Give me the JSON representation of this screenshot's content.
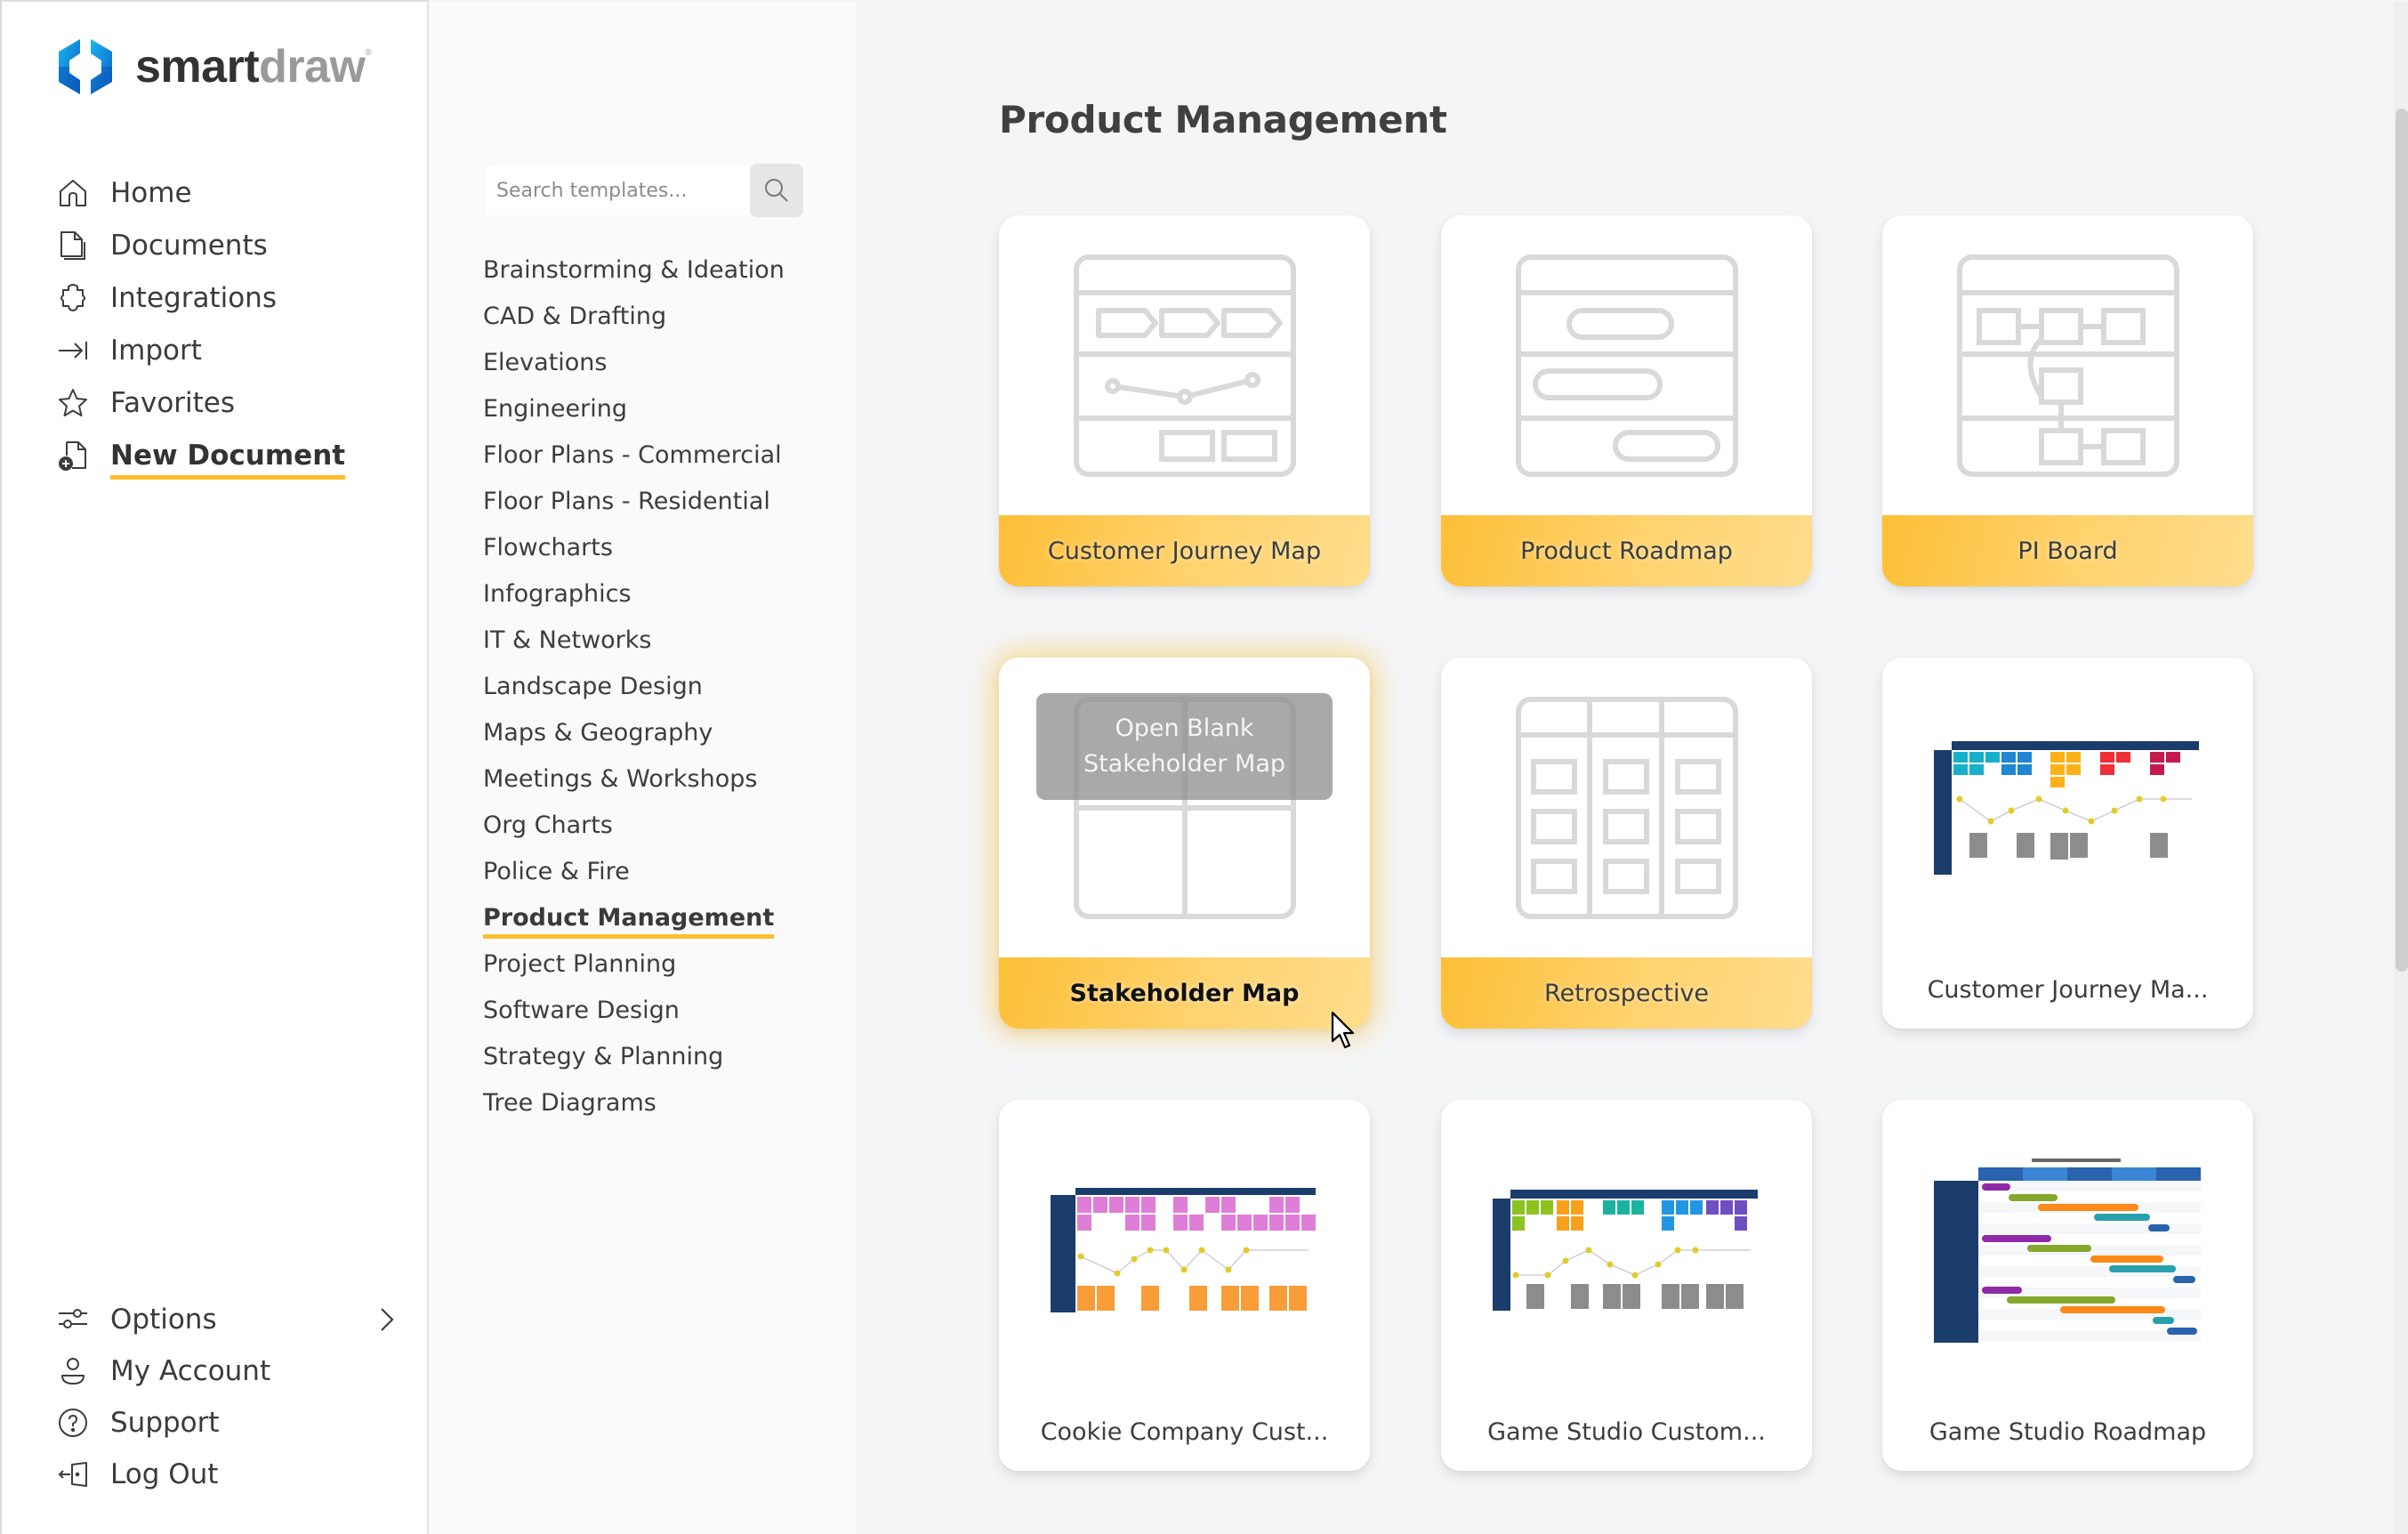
{
  "app": {
    "logo_primary": "smart",
    "logo_secondary": "draw",
    "logo_mark": "®",
    "brand_accent": "#fbbf2d",
    "brand_blue": "#1a7fd8"
  },
  "sidebar": {
    "nav_items": [
      {
        "label": "Home",
        "icon": "home-icon"
      },
      {
        "label": "Documents",
        "icon": "documents-icon"
      },
      {
        "label": "Integrations",
        "icon": "puzzle-icon"
      },
      {
        "label": "Import",
        "icon": "import-icon"
      },
      {
        "label": "Favorites",
        "icon": "star-icon"
      },
      {
        "label": "New Document",
        "icon": "new-document-icon",
        "active": true
      }
    ],
    "bottom_items": [
      {
        "label": "Options",
        "icon": "sliders-icon",
        "has_submenu": true
      },
      {
        "label": "My Account",
        "icon": "user-icon"
      },
      {
        "label": "Support",
        "icon": "help-icon"
      },
      {
        "label": "Log Out",
        "icon": "logout-icon"
      }
    ]
  },
  "categories": {
    "search_placeholder": "Search templates...",
    "search_value": "",
    "items": [
      "Brainstorming & Ideation",
      "CAD & Drafting",
      "Elevations",
      "Engineering",
      "Floor Plans - Commercial",
      "Floor Plans - Residential",
      "Flowcharts",
      "Infographics",
      "IT & Networks",
      "Landscape Design",
      "Maps & Geography",
      "Meetings & Workshops",
      "Org Charts",
      "Police & Fire",
      "Product Management",
      "Project Planning",
      "Software Design",
      "Strategy & Planning",
      "Tree Diagrams"
    ],
    "active": "Product Management"
  },
  "main": {
    "title": "Product Management",
    "cards": [
      {
        "label": "Customer Journey Map",
        "kind": "blank",
        "icon": "customer-journey-map-icon"
      },
      {
        "label": "Product Roadmap",
        "kind": "blank",
        "icon": "product-roadmap-icon"
      },
      {
        "label": "PI Board",
        "kind": "blank",
        "icon": "pi-board-icon"
      },
      {
        "label": "Stakeholder Map",
        "kind": "blank",
        "icon": "stakeholder-map-icon",
        "hovered": true,
        "overlay_line1": "Open Blank",
        "overlay_line2": "Stakeholder Map"
      },
      {
        "label": "Retrospective",
        "kind": "blank",
        "icon": "retrospective-icon"
      },
      {
        "label": "Customer Journey Ma...",
        "kind": "template",
        "thumb": "journey-map-thumbnail"
      },
      {
        "label": "Cookie Company Cust...",
        "kind": "template",
        "thumb": "cookie-journey-thumbnail"
      },
      {
        "label": "Game Studio Custom...",
        "kind": "template",
        "thumb": "game-studio-journey-thumbnail"
      },
      {
        "label": "Game Studio Roadmap",
        "kind": "template",
        "thumb": "game-studio-roadmap-thumbnail"
      }
    ]
  }
}
